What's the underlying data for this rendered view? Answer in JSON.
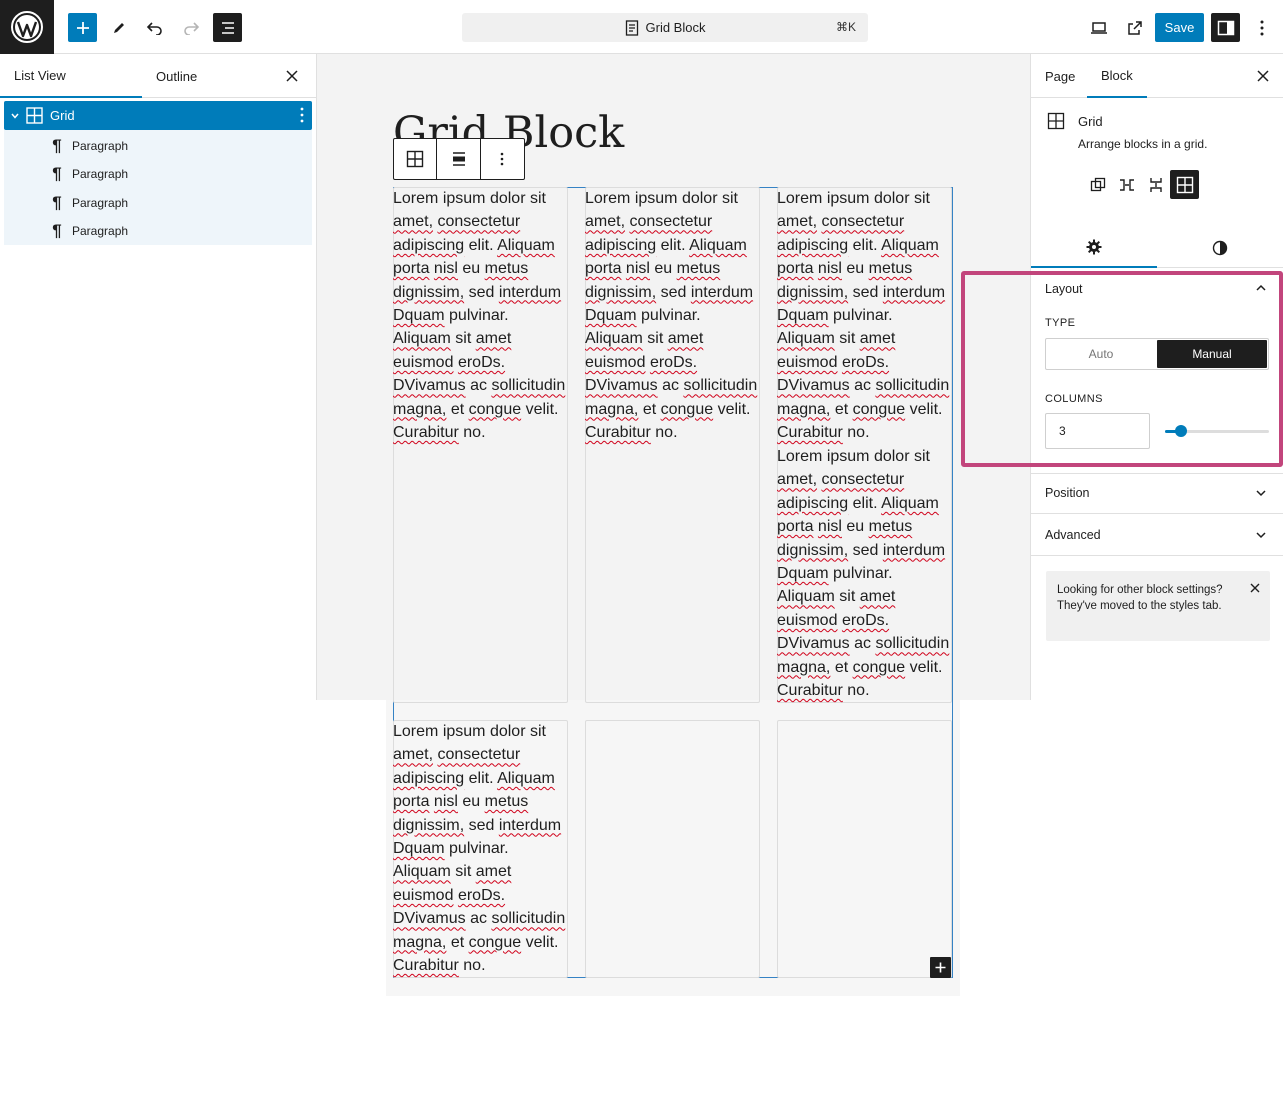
{
  "header": {
    "document_title": "Grid Block",
    "shortcut": "⌘K",
    "save_label": "Save"
  },
  "left_panel": {
    "tabs": [
      "List View",
      "Outline"
    ],
    "tree": {
      "root_label": "Grid",
      "children": [
        "Paragraph",
        "Paragraph",
        "Paragraph",
        "Paragraph"
      ]
    }
  },
  "canvas": {
    "title": "Grid Block",
    "paragraph_lines": [
      [
        "Lorem ipsum dolor sit",
        "amet, consectetur",
        "adipiscing elit. Aliquam",
        "porta nisl eu metus",
        "dignissim, sed interdum",
        "Dquam pulvinar.",
        "Aliquam sit amet",
        "euismod eroDs.",
        "DVivamus ac sollicitudin",
        "magna, et congue velit.",
        "Curabitur no."
      ]
    ]
  },
  "right_panel": {
    "tabs": [
      "Page",
      "Block"
    ],
    "block_name": "Grid",
    "block_description": "Arrange blocks in a grid.",
    "layout": {
      "title": "Layout",
      "type_label": "TYPE",
      "type_options": [
        "Auto",
        "Manual"
      ],
      "selected_type": "Manual",
      "columns_label": "COLUMNS",
      "columns_value": "3",
      "columns_slider_fraction": 0.15
    },
    "position_title": "Position",
    "advanced_title": "Advanced",
    "notice": "Looking for other block settings? They've moved to the styles tab."
  },
  "colors": {
    "accent": "#007cba",
    "dark": "#1e1e1e",
    "highlight": "#c2457c"
  }
}
